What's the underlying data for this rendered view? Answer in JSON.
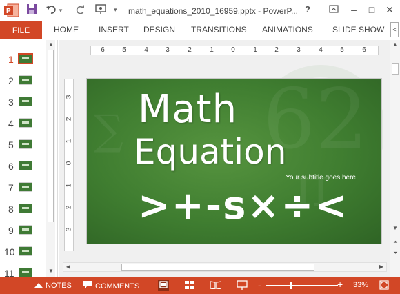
{
  "titlebar": {
    "title": "math_equations_2010_16959.pptx - PowerP...",
    "help": "?",
    "minimize": "–",
    "maximize": "□",
    "close": "✕"
  },
  "ribbon": {
    "file": "FILE",
    "tabs": [
      "HOME",
      "INSERT",
      "DESIGN",
      "TRANSITIONS",
      "ANIMATIONS",
      "SLIDE SHOW"
    ],
    "collapse": "<"
  },
  "thumbnails": {
    "numbers": [
      "1",
      "2",
      "3",
      "4",
      "5",
      "6",
      "7",
      "8",
      "9",
      "10",
      "11"
    ],
    "active_index": 0
  },
  "rulers": {
    "horizontal": [
      "6",
      "5",
      "4",
      "3",
      "2",
      "1",
      "0",
      "1",
      "2",
      "3",
      "4",
      "5",
      "6"
    ],
    "vertical": [
      "3",
      "2",
      "1",
      "0",
      "1",
      "2",
      "3"
    ]
  },
  "slide": {
    "title_line1": "Math",
    "title_line2": "Equation",
    "subtitle": "Your subtitle goes here",
    "symbols": ">+-s×÷<",
    "background_color": "#3f7d30"
  },
  "statusbar": {
    "notes": "NOTES",
    "comments": "COMMENTS",
    "zoom_minus": "-",
    "zoom_plus": "+",
    "zoom": "33%",
    "zoom_fraction": 0.33
  },
  "colors": {
    "accent": "#d24726",
    "slide_green": "#3f7d30"
  }
}
